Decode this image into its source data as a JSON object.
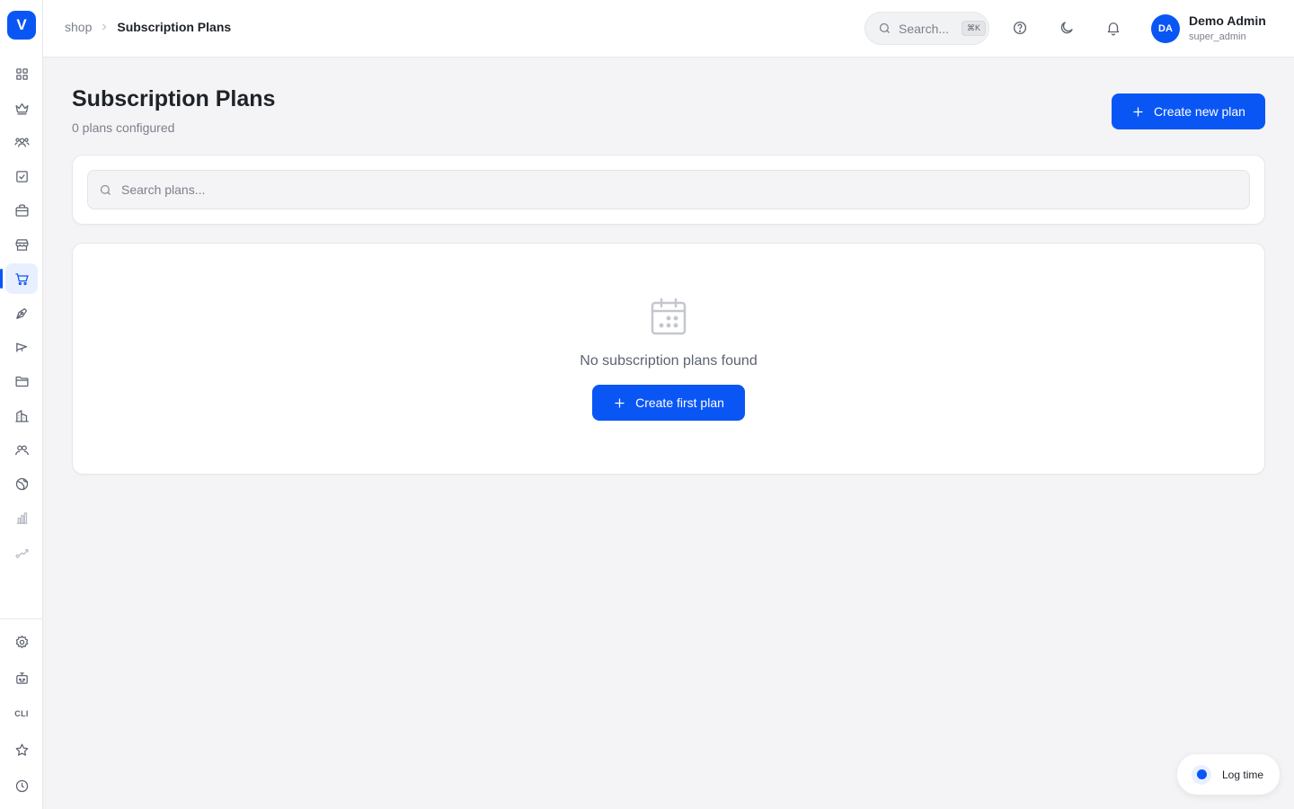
{
  "app": {
    "logo_letter": "V",
    "accent_color": "#0a56f5"
  },
  "sidebar": {
    "items": [
      {
        "name": "dashboard",
        "icon": "grid-icon"
      },
      {
        "name": "plans",
        "icon": "crown-icon"
      },
      {
        "name": "users",
        "icon": "users-icon"
      },
      {
        "name": "tasks",
        "icon": "checkbox-icon"
      },
      {
        "name": "products",
        "icon": "briefcase-icon"
      },
      {
        "name": "store",
        "icon": "store-icon"
      },
      {
        "name": "shop",
        "icon": "cart-icon",
        "active": true
      },
      {
        "name": "design",
        "icon": "pen-icon"
      },
      {
        "name": "marketing",
        "icon": "megaphone-icon"
      },
      {
        "name": "files",
        "icon": "folder-icon"
      },
      {
        "name": "company",
        "icon": "building-icon"
      },
      {
        "name": "team",
        "icon": "team-icon"
      },
      {
        "name": "web",
        "icon": "globe-icon"
      },
      {
        "name": "analytics",
        "icon": "bar-chart-icon"
      },
      {
        "name": "trends",
        "icon": "trend-icon"
      }
    ],
    "bottom_items": [
      {
        "name": "settings",
        "icon": "gear-icon"
      },
      {
        "name": "bot",
        "icon": "robot-icon"
      },
      {
        "name": "cli",
        "label": "CLI"
      },
      {
        "name": "favorites",
        "icon": "star-icon"
      },
      {
        "name": "history",
        "icon": "clock-icon"
      }
    ],
    "cli_label": "CLI"
  },
  "header": {
    "breadcrumb": {
      "parent": "shop",
      "current": "Subscription Plans"
    },
    "search": {
      "placeholder": "Search...",
      "shortcut": "⌘K"
    },
    "user": {
      "initials": "DA",
      "name": "Demo Admin",
      "role": "super_admin"
    }
  },
  "main": {
    "title": "Subscription Plans",
    "subtitle": "0 plans configured",
    "create_button_label": "Create new plan",
    "search_placeholder": "Search plans...",
    "empty_state": {
      "message": "No subscription plans found",
      "button_label": "Create first plan",
      "icon": "calendar-icon"
    }
  },
  "log_time": {
    "label": "Log time"
  }
}
